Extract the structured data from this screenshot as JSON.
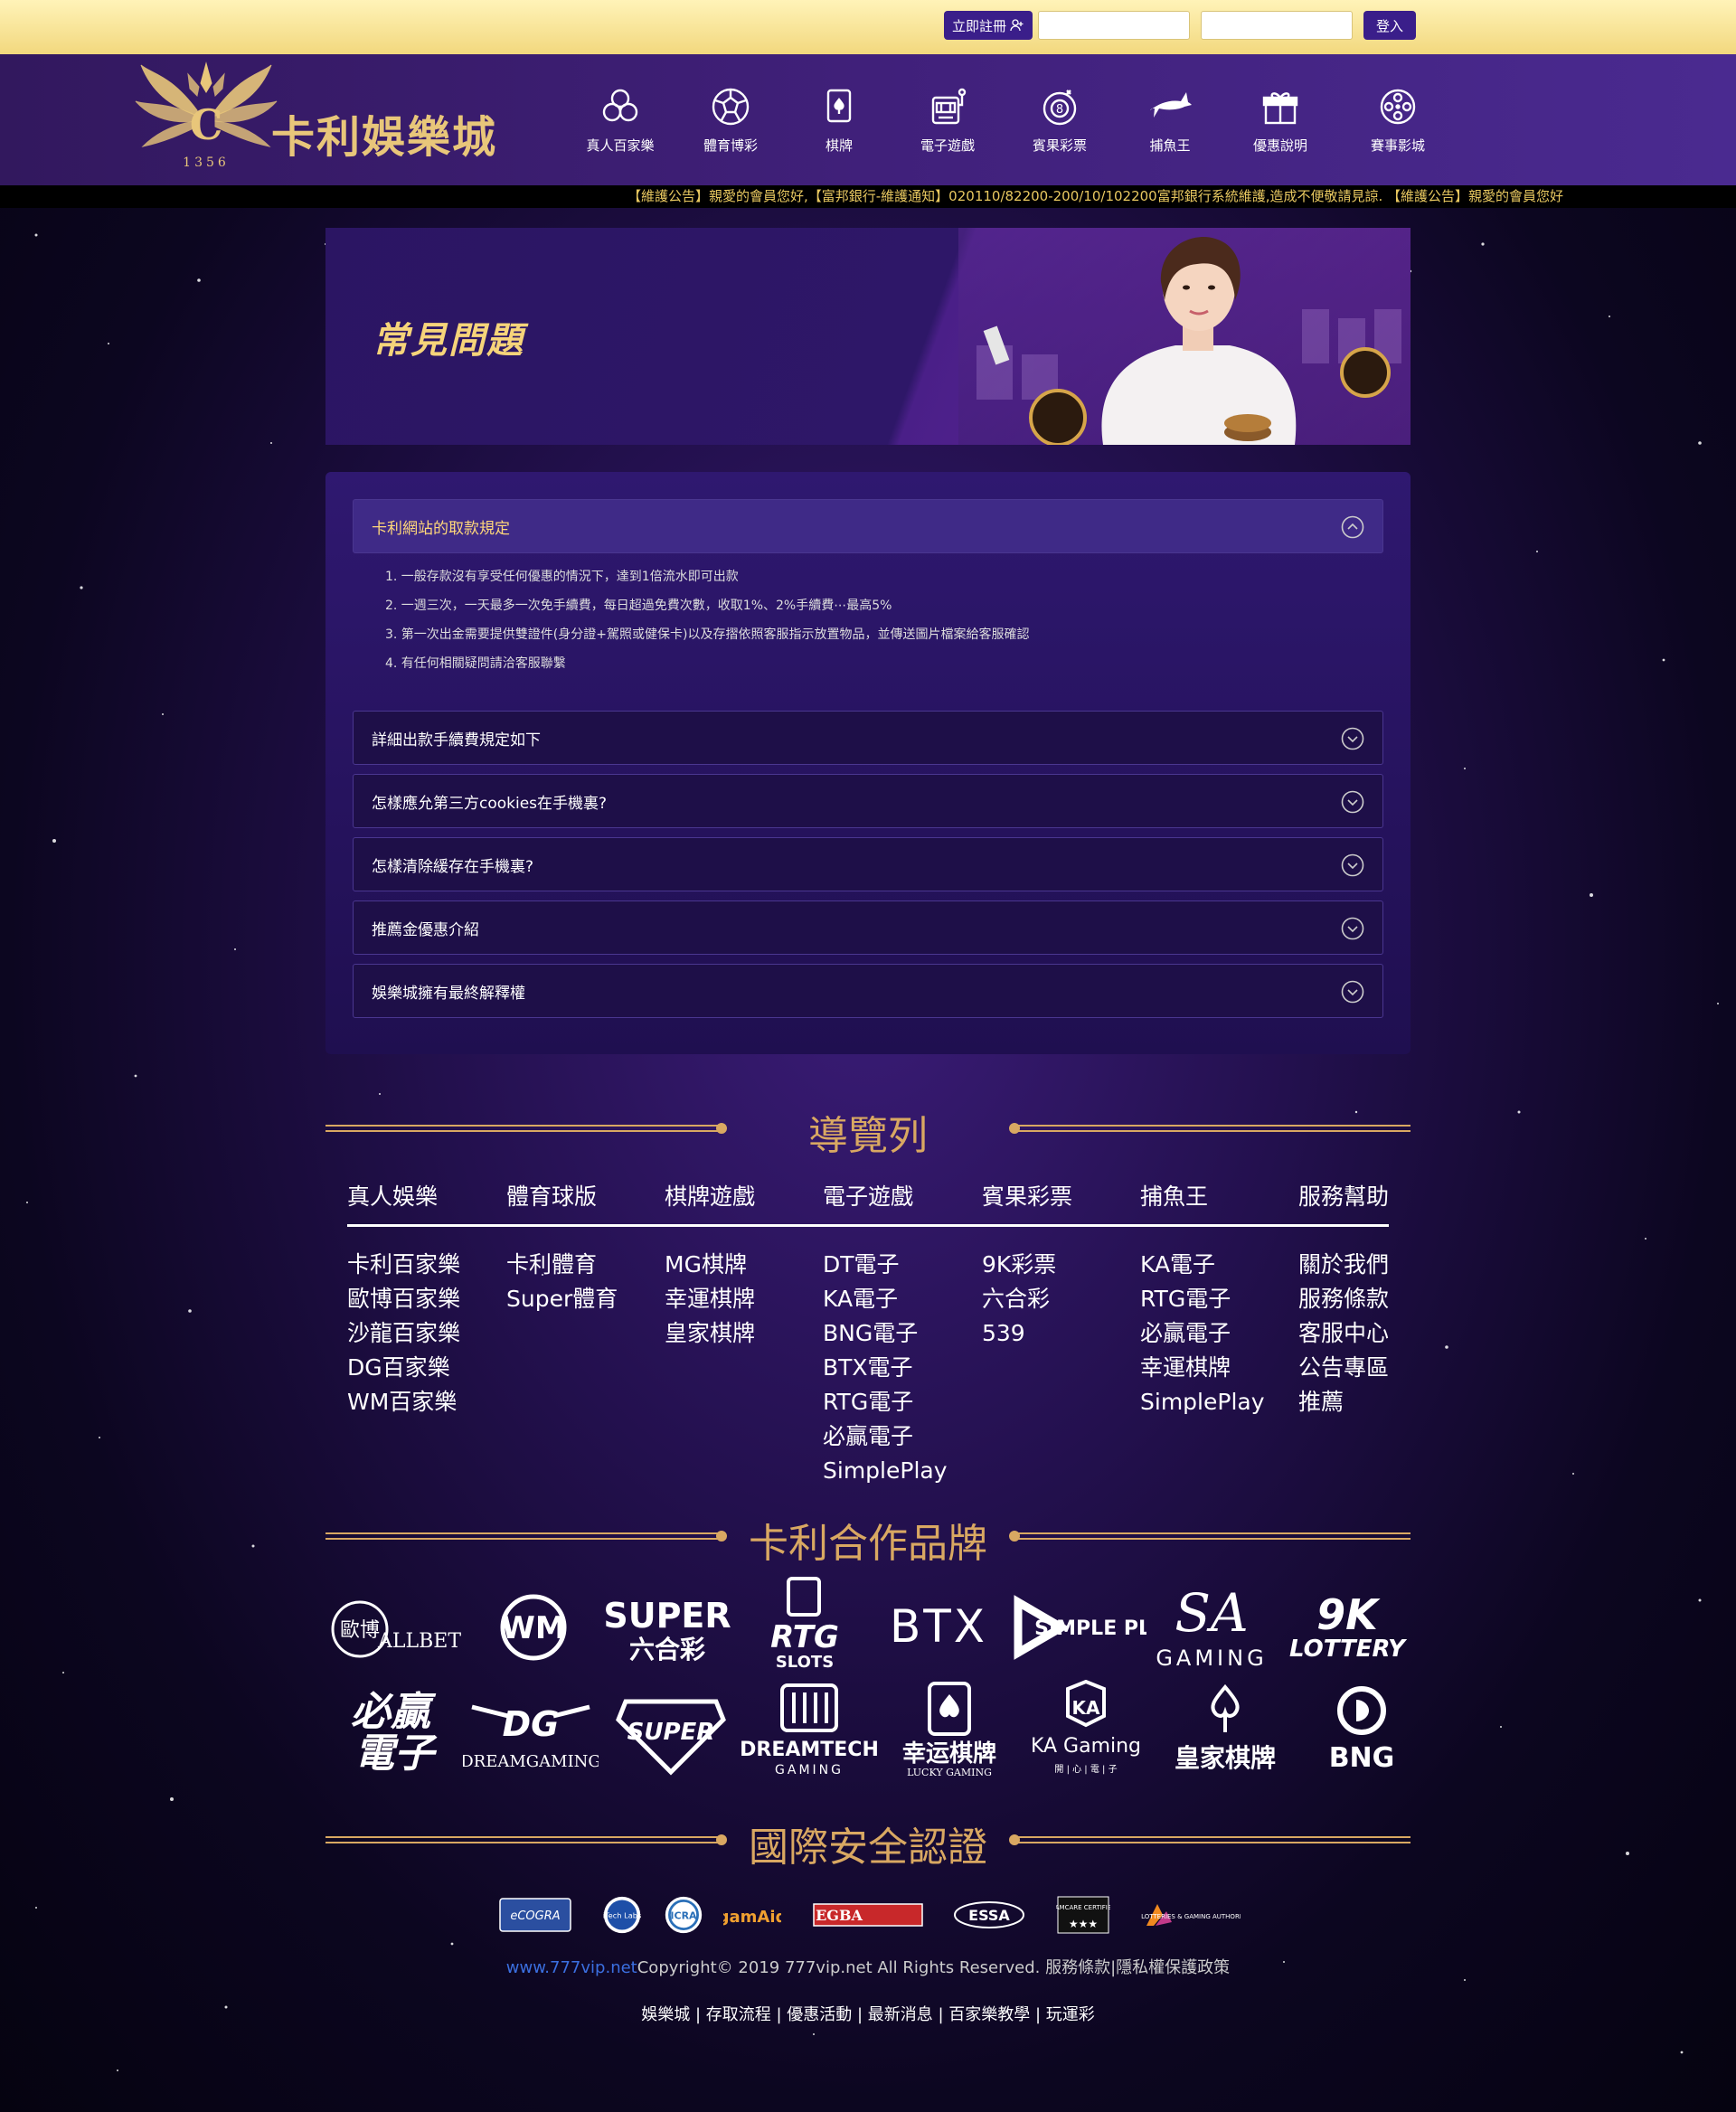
{
  "topbar": {
    "register_label": "立即註冊",
    "login_label": "登入",
    "account_placeholder": "",
    "password_placeholder": ""
  },
  "header": {
    "brand_name": "卡利娛樂城",
    "brand_number": "1356",
    "nav": [
      {
        "label": "真人百家樂",
        "icon": "chips-icon"
      },
      {
        "label": "體育博彩",
        "icon": "soccer-ball-icon"
      },
      {
        "label": "棋牌",
        "icon": "playing-cards-icon"
      },
      {
        "label": "電子遊戲",
        "icon": "slot-machine-icon"
      },
      {
        "label": "賓果彩票",
        "icon": "lottery-ball-icon"
      },
      {
        "label": "捕魚王",
        "icon": "shark-icon"
      },
      {
        "label": "優惠說明",
        "icon": "gift-icon"
      },
      {
        "label": "賽事影城",
        "icon": "film-reel-icon"
      }
    ]
  },
  "marquee": "【維護公告】親愛的會員您好,【富邦銀行-維護通知】020110/82200-200/10/102200富邦銀行系統維護,造成不便敬請見諒.   【維護公告】親愛的會員您好",
  "banner": {
    "title": "常見問題"
  },
  "faq": {
    "items": [
      {
        "title": "卡利網站的取款規定",
        "open": true,
        "lines": [
          "1. 一般存款沒有享受任何優惠的情況下，達到1倍流水即可出款",
          "2. 一週三次，一天最多一次免手續費，每日超過免費次數，收取1%、2%手續費⋯最高5%",
          "3. 第一次出金需要提供雙證件(身分證+駕照或健保卡)以及存摺依照客服指示放置物品，並傳送圖片檔案給客服確認",
          "4. 有任何相關疑問請洽客服聯繫"
        ]
      },
      {
        "title": "詳細出款手續費規定如下",
        "open": false
      },
      {
        "title": "怎樣應允第三方cookies在手機裏?",
        "open": false
      },
      {
        "title": "怎樣清除緩存在手機裏?",
        "open": false
      },
      {
        "title": "推薦金優惠介紹",
        "open": false
      },
      {
        "title": "娛樂城擁有最終解釋權",
        "open": false
      }
    ]
  },
  "sitemap": {
    "title": "導覽列",
    "columns": [
      {
        "head": "真人娛樂",
        "links": [
          "卡利百家樂",
          "歐博百家樂",
          "沙龍百家樂",
          "DG百家樂",
          "WM百家樂"
        ]
      },
      {
        "head": "體育球版",
        "links": [
          "卡利體育",
          "Super體育"
        ]
      },
      {
        "head": "棋牌遊戲",
        "links": [
          "MG棋牌",
          "幸運棋牌",
          "皇家棋牌"
        ]
      },
      {
        "head": "電子遊戲",
        "links": [
          "DT電子",
          "KA電子",
          "BNG電子",
          "BTX電子",
          "RTG電子",
          "必贏電子",
          "SimplePlay"
        ]
      },
      {
        "head": "賓果彩票",
        "links": [
          "9K彩票",
          "六合彩",
          "539"
        ]
      },
      {
        "head": "捕魚王",
        "links": [
          "KA電子",
          "RTG電子",
          "必贏電子",
          "幸運棋牌",
          "SimplePlay"
        ]
      },
      {
        "head": "服務幫助",
        "links": [
          "關於我們",
          "服務條款",
          "客服中心",
          "公告專區",
          "推薦"
        ]
      }
    ]
  },
  "partners": {
    "title": "卡利合作品牌",
    "brands": [
      {
        "name": "ALLBET",
        "glyph": "歐博"
      },
      {
        "name": "WM",
        "glyph": ""
      },
      {
        "name": "SUPER",
        "glyph": "六合彩"
      },
      {
        "name": "RTG",
        "glyph": "SLOTS"
      },
      {
        "name": "BTX",
        "glyph": ""
      },
      {
        "name": "SIMPLE PLAY",
        "glyph": ""
      },
      {
        "name": "SA",
        "glyph": "GAMING"
      },
      {
        "name": "9K",
        "glyph": "LOTTERY"
      },
      {
        "name": "必贏",
        "glyph": "電子"
      },
      {
        "name": "DG",
        "glyph": "DREAMGAMING"
      },
      {
        "name": "SUPER",
        "glyph": ""
      },
      {
        "name": "DREAMTECH",
        "glyph": "GAMING"
      },
      {
        "name": "幸运棋牌",
        "glyph": "LUCKY GAMING"
      },
      {
        "name": "KA Gaming",
        "glyph": "開 | 心 | 電 | 子"
      },
      {
        "name": "皇家棋牌",
        "glyph": ""
      },
      {
        "name": "BNG",
        "glyph": ""
      }
    ]
  },
  "certs": {
    "title": "國際安全認證",
    "items": [
      "eCOGRA",
      "iTech Labs",
      "ICRA",
      "gamAid",
      "EGBA",
      "ESSA",
      "GAMCARE CERTIFIED",
      "LOTTERIES & GAMING AUTHORITY MALTA"
    ]
  },
  "footer": {
    "site": "www.777vip.net",
    "copyright": "Copyright© 2019 777vip.net All Rights Reserved. 服務條款|隱私權保護政策",
    "links": "娛樂城 | 存取流程 | 優惠活動 | 最新消息 | 百家樂教學 | 玩運彩"
  },
  "colors": {
    "gold": "#e8c67a",
    "topbar": "#f2d87e",
    "header": "#3a1e7a",
    "accent": "#3a1e8a"
  }
}
